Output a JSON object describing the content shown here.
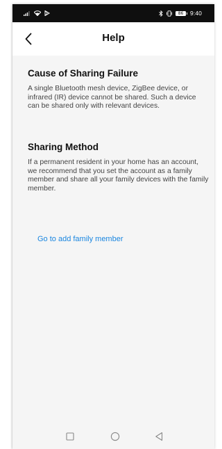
{
  "status_bar": {
    "time": "9:40",
    "battery": "86"
  },
  "header": {
    "back_icon": "chevron-left-icon",
    "title": "Help"
  },
  "sections": [
    {
      "heading": "Cause of Sharing Failure",
      "body": "A single Bluetooth mesh device, ZigBee device, or infrared (IR) device cannot be shared. Such a device can be shared only with relevant devices."
    },
    {
      "heading": "Sharing Method",
      "body": "If a permanent resident in your home has an account, we recommend that you set the account as a family member and share all your family devices with the family member."
    }
  ],
  "action_link": "Go to add family member",
  "colors": {
    "link": "#1a86e0",
    "background": "#f5f5f5",
    "status_bar": "#0f0f0f"
  },
  "system_nav": {
    "icons": [
      "recent-apps-icon",
      "home-icon",
      "back-triangle-icon"
    ]
  }
}
